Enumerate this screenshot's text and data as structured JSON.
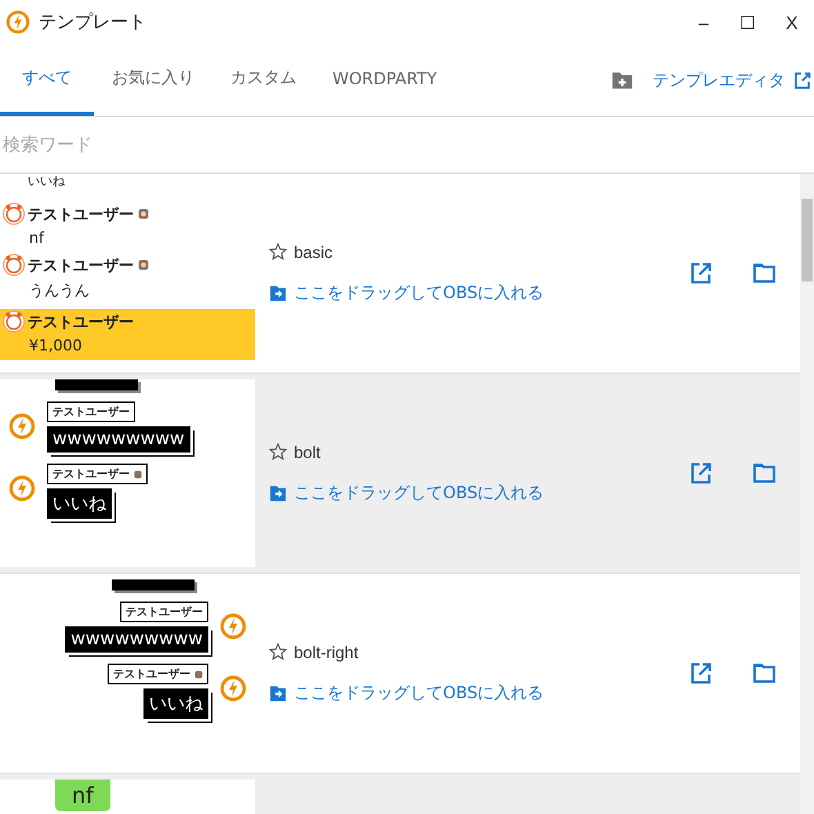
{
  "window": {
    "title": "テンプレート",
    "controls": [
      "–",
      "☐",
      "X"
    ]
  },
  "tabs": [
    {
      "label": "すべて",
      "selected": true
    },
    {
      "label": "お気に入り",
      "selected": false
    },
    {
      "label": "カスタム",
      "selected": false
    },
    {
      "label": "WORDPARTY",
      "selected": false
    }
  ],
  "editor_link": "テンプレエディタ",
  "search": {
    "placeholder": "検索ワード"
  },
  "templates": [
    {
      "name": "basic",
      "kind": "basic",
      "favorite": false,
      "shaded": false,
      "drag_hint": "ここをドラッグしてOBSに入れる",
      "preview": {
        "lead": "いいね",
        "comments": [
          {
            "kind": "member",
            "user": "テストユーザー",
            "text": "nf"
          },
          {
            "kind": "member",
            "user": "テストユーザー",
            "text": "うんうん"
          },
          {
            "kind": "superchat",
            "user": "テストユーザー",
            "text": "¥1,000"
          }
        ]
      }
    },
    {
      "name": "bolt",
      "kind": "bolt",
      "favorite": false,
      "shaded": true,
      "drag_hint": "ここをドラッグしてOBSに入れる",
      "preview": {
        "comments": [
          {
            "user": "テストユーザー",
            "badge": false,
            "text": "wwwwwwwww"
          },
          {
            "user": "テストユーザー",
            "badge": true,
            "text": "いいね"
          }
        ]
      }
    },
    {
      "name": "bolt-right",
      "kind": "bolt-right",
      "favorite": false,
      "shaded": false,
      "drag_hint": "ここをドラッグしてOBSに入れる",
      "preview": {
        "comments": [
          {
            "user": "テストユーザー",
            "badge": false,
            "text": "wwwwwwwww"
          },
          {
            "user": "テストユーザー",
            "badge": true,
            "text": "いいね"
          }
        ]
      }
    },
    {
      "kind": "green",
      "shaded": true,
      "preview": {
        "comments": [
          {
            "text": "nf"
          }
        ]
      }
    }
  ]
}
